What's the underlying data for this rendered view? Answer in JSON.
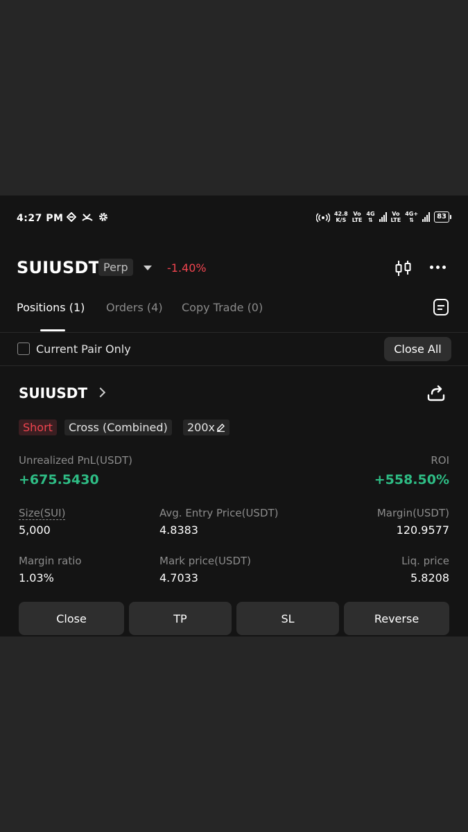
{
  "status": {
    "time": "4:27 PM",
    "net_speed": "42.8",
    "net_unit": "K/S",
    "vo1": "Vo",
    "lte1": "LTE",
    "g1": "4G",
    "vo2": "Vo",
    "lte2": "LTE",
    "g2": "4G+",
    "battery": "83"
  },
  "header": {
    "pair": "SUIUSDT",
    "contract_type": "Perp",
    "change": "-1.40%"
  },
  "tabs": [
    {
      "label": "Positions (1)"
    },
    {
      "label": "Orders (4)"
    },
    {
      "label": "Copy Trade (0)"
    }
  ],
  "filter": {
    "current_pair_label": "Current Pair Only",
    "close_all_label": "Close All"
  },
  "position": {
    "symbol": "SUIUSDT",
    "side": "Short",
    "margin_mode": "Cross (Combined)",
    "leverage": "200x",
    "pnl_label": "Unrealized PnL(USDT)",
    "pnl_value": "+675.5430",
    "roi_label": "ROI",
    "roi_value": "+558.50%",
    "size_label": "Size(SUI)",
    "size_value": "5,000",
    "entry_label": "Avg. Entry Price(USDT)",
    "entry_value": "4.8383",
    "margin_label": "Margin(USDT)",
    "margin_value": "120.9577",
    "ratio_label": "Margin ratio",
    "ratio_value": "1.03%",
    "mark_label": "Mark price(USDT)",
    "mark_value": "4.7033",
    "liq_label": "Liq. price",
    "liq_value": "5.8208"
  },
  "actions": {
    "close": "Close",
    "tp": "TP",
    "sl": "SL",
    "reverse": "Reverse"
  },
  "colors": {
    "negative": "#f0444f",
    "positive": "#2ebd85",
    "background": "#141414"
  }
}
